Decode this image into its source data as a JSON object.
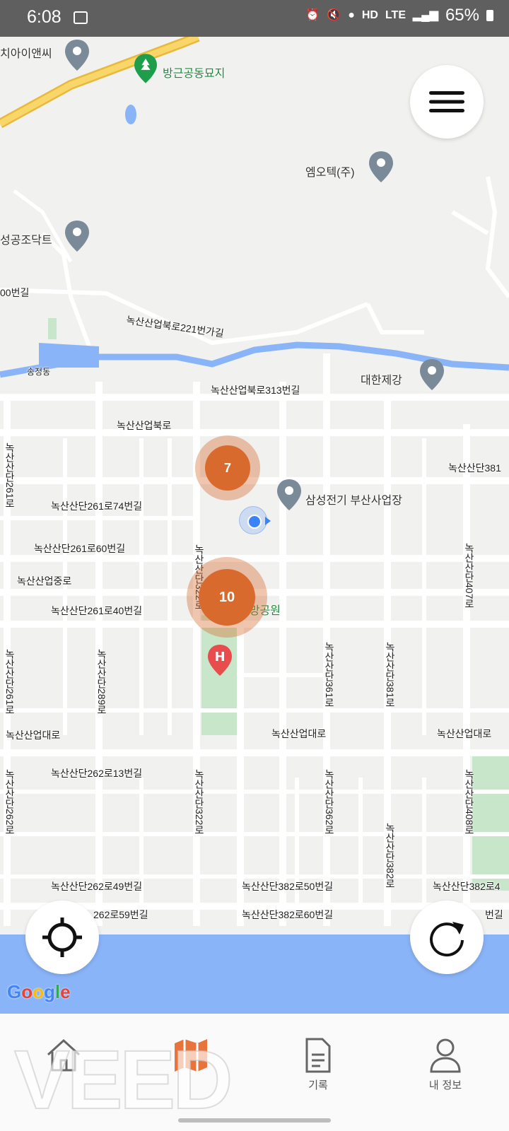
{
  "status": {
    "time": "6:08",
    "net": "HD",
    "lte": "LTE",
    "battery": "65%"
  },
  "map": {
    "poi": {
      "top_left": "치아이앤씨",
      "cemetery": "방근공동묘지",
      "mtech": "엠오텍(주)",
      "duct": "성공조닥트",
      "daehan": "대한제강",
      "samsung": "삼성전기 부산사업장",
      "park": "희망공원"
    },
    "roads": {
      "r1": "00번길",
      "r2": "녹산산업북로221번가길",
      "r3": "송정동",
      "r4": "녹산산업북로313번길",
      "r5": "녹산산업북로",
      "r6": "녹산산단381",
      "r7": "녹산산단261로74번길",
      "r8": "녹산산단261로60번길",
      "r9": "녹산산업중로",
      "r10": "녹산산단261로40번길",
      "r11": "녹산산업대로",
      "r12": "녹산산업대로",
      "r13": "녹산산업대로",
      "r14": "녹산산단262로13번길",
      "r15": "녹산산단262로49번길",
      "r16": "녹산산단382로50번길",
      "r17": "녹산산단382로4",
      "r18": "262로59번길",
      "r19": "녹산산단382로60번길",
      "r20": "번길",
      "v1": "녹산산단261로",
      "v2": "녹산산단261로",
      "v3": "녹산산단289로",
      "v4": "녹산산단262로",
      "v5": "녹산산단322로",
      "v6": "녹산산단361로",
      "v7": "녹산산단362로",
      "v8": "녹산산단381로",
      "v9": "녹산산단382로",
      "v10": "녹산산단407로",
      "v11": "녹산산단408로",
      "v12": "녹산산단322로"
    },
    "clusters": [
      {
        "count": "7"
      },
      {
        "count": "10"
      }
    ],
    "hospital_letter": "H",
    "google": "Google"
  },
  "nav": {
    "items": [
      {
        "label": "",
        "icon": "home-icon"
      },
      {
        "label": "",
        "icon": "map-icon"
      },
      {
        "label": "기록",
        "icon": "document-icon"
      },
      {
        "label": "내 정보",
        "icon": "person-icon"
      }
    ]
  },
  "watermark": "VEED",
  "colors": {
    "accent": "#d86a2e",
    "water": "#8ab4f8",
    "park": "#c8e6c9",
    "highway": "#f5c542"
  }
}
